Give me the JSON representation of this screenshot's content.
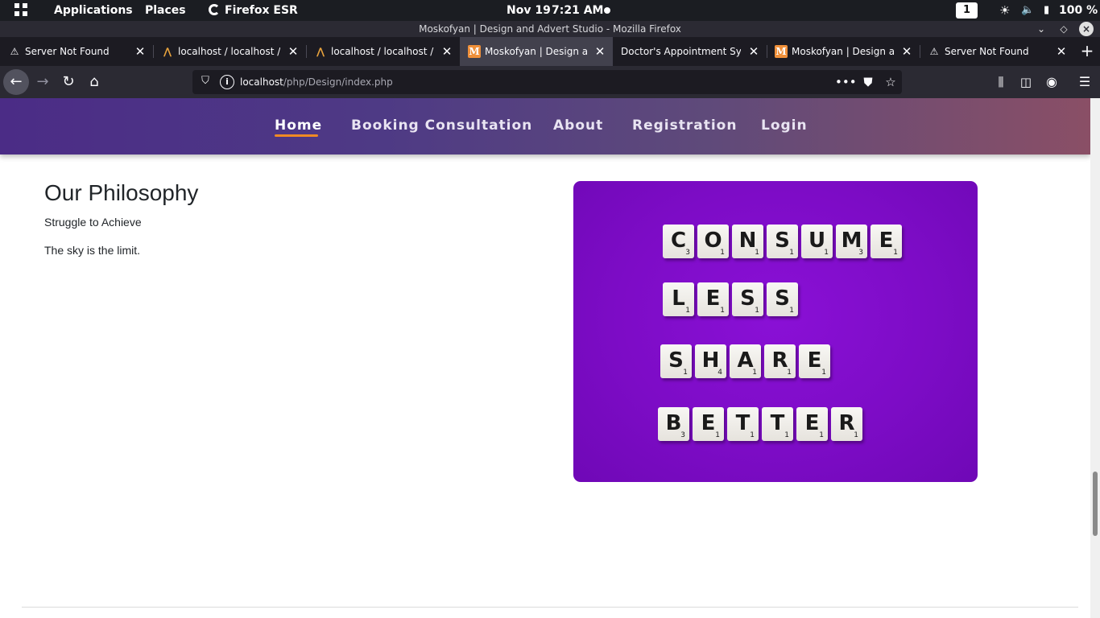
{
  "system_bar": {
    "applications": "Applications",
    "places": "Places",
    "browser": "Firefox ESR",
    "date": "Nov 19",
    "time": "7:21 AM",
    "workspace": "1",
    "battery": "100 %"
  },
  "window": {
    "title": "Moskofyan | Design and Advert Studio - Mozilla Firefox"
  },
  "tabs": [
    {
      "label": "Server Not Found",
      "icon": "warning-icon"
    },
    {
      "label": "localhost / localhost / doc",
      "icon": "phpmyadmin-icon"
    },
    {
      "label": "localhost / localhost / cdf",
      "icon": "phpmyadmin-icon"
    },
    {
      "label": "Moskofyan | Design and",
      "icon": "moskofyan-m-icon",
      "active": true
    },
    {
      "label": "Doctor's Appointment System",
      "icon": "none"
    },
    {
      "label": "Moskofyan | Design and",
      "icon": "moskofyan-m-icon"
    },
    {
      "label": "Server Not Found",
      "icon": "warning-icon"
    }
  ],
  "address_bar": {
    "host": "localhost",
    "path": "/php/Design/index.php"
  },
  "site_nav": {
    "items": [
      "Home",
      "Booking Consultation",
      "About",
      "Registration",
      "Login"
    ],
    "active": "Home"
  },
  "content": {
    "heading": "Our Philosophy",
    "line1": "Struggle to Achieve",
    "line2": "The sky is the limit."
  },
  "image": {
    "rows": [
      {
        "word": "CONSUME",
        "scores": [
          "3",
          "1",
          "1",
          "1",
          "1",
          "3",
          "1"
        ]
      },
      {
        "word": "LESS",
        "scores": [
          "1",
          "1",
          "1",
          "1"
        ]
      },
      {
        "word": "SHARE",
        "scores": [
          "1",
          "4",
          "1",
          "1",
          "1"
        ]
      },
      {
        "word": "BETTER",
        "scores": [
          "3",
          "1",
          "1",
          "1",
          "1",
          "1"
        ]
      }
    ],
    "background_color": "#7d0cc6"
  },
  "colors": {
    "nav_gradient_start": "#4b2c86",
    "nav_gradient_end": "#8a4f66",
    "active_underline": "#f08a24"
  }
}
